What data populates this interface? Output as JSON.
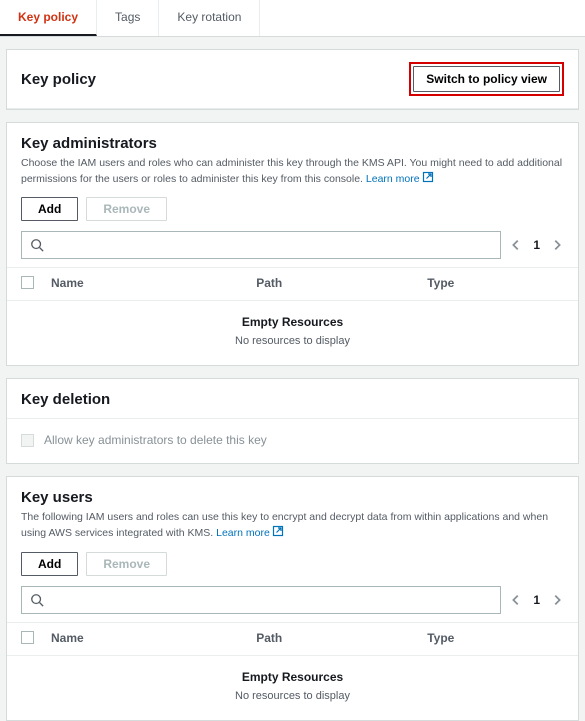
{
  "tabs": {
    "key_policy": "Key policy",
    "tags": "Tags",
    "key_rotation": "Key rotation"
  },
  "policy_header": {
    "title": "Key policy",
    "switch_btn": "Switch to policy view"
  },
  "admins": {
    "title": "Key administrators",
    "desc": "Choose the IAM users and roles who can administer this key through the KMS API. You might need to add additional permissions for the users or roles to administer this key from this console. ",
    "learn_more": "Learn more",
    "add_btn": "Add",
    "remove_btn": "Remove",
    "page": "1",
    "cols": {
      "name": "Name",
      "path": "Path",
      "type": "Type"
    },
    "empty_title": "Empty Resources",
    "empty_sub": "No resources to display"
  },
  "deletion": {
    "title": "Key deletion",
    "checkbox_label": "Allow key administrators to delete this key"
  },
  "users": {
    "title": "Key users",
    "desc": "The following IAM users and roles can use this key to encrypt and decrypt data from within applications and when using AWS services integrated with KMS. ",
    "learn_more": "Learn more",
    "add_btn": "Add",
    "remove_btn": "Remove",
    "page": "1",
    "cols": {
      "name": "Name",
      "path": "Path",
      "type": "Type"
    },
    "empty_title": "Empty Resources",
    "empty_sub": "No resources to display"
  }
}
